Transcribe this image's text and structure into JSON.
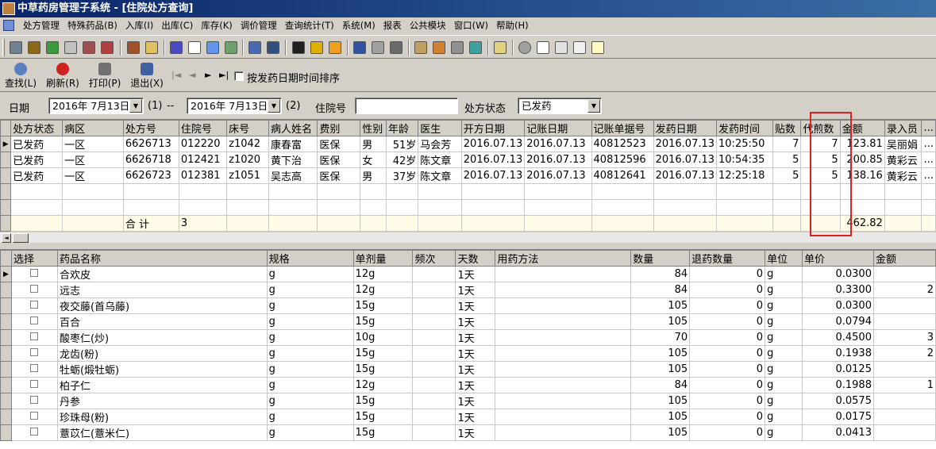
{
  "window": {
    "title": "中草药房管理子系统 - [住院处方查询]"
  },
  "menu": [
    "处方管理",
    "特殊药品(B)",
    "入库(I)",
    "出库(C)",
    "库存(K)",
    "调价管理",
    "查询统计(T)",
    "系统(M)",
    "报表",
    "公共模块",
    "窗口(W)",
    "帮助(H)"
  ],
  "toolbar": {
    "find": "查找(L)",
    "refresh": "刷新(R)",
    "print": "打印(P)",
    "exit": "退出(X)",
    "nav_first": "|◄",
    "nav_prev": "◄",
    "nav_next": "►",
    "nav_last": "►|",
    "sort_checkbox_label": "按发药日期时间排序"
  },
  "filter": {
    "date_label": "日期",
    "date_from": "2016年 7月13日",
    "from_marker": "(1)",
    "dash": "--",
    "date_to": "2016年 7月13日",
    "to_marker": "(2)",
    "inpatient_no_label": "住院号",
    "inpatient_no_value": "",
    "status_label": "处方状态",
    "status_value": "已发药"
  },
  "upper_grid": {
    "columns": [
      "处方状态",
      "病区",
      "处方号",
      "住院号",
      "床号",
      "病人姓名",
      "费别",
      "性别",
      "年龄",
      "医生",
      "开方日期",
      "记账日期",
      "记账单据号",
      "发药日期",
      "发药时间",
      "贴数",
      "代煎数",
      "金额",
      "录入员",
      "..."
    ],
    "rows": [
      [
        "已发药",
        "一区",
        "6626713",
        "012220",
        "z1042",
        "康春富",
        "医保",
        "男",
        "51岁",
        "马会芳",
        "2016.07.13",
        "2016.07.13",
        "40812523",
        "2016.07.13",
        "10:25:50",
        "7",
        "7",
        "123.81",
        "吴丽娟",
        "..."
      ],
      [
        "已发药",
        "一区",
        "6626718",
        "012421",
        "z1020",
        "黄下治",
        "医保",
        "女",
        "42岁",
        "陈文章",
        "2016.07.13",
        "2016.07.13",
        "40812596",
        "2016.07.13",
        "10:54:35",
        "5",
        "5",
        "200.85",
        "黄彩云",
        "..."
      ],
      [
        "已发药",
        "一区",
        "6626723",
        "012381",
        "z1051",
        "吴志高",
        "医保",
        "男",
        "37岁",
        "陈文章",
        "2016.07.13",
        "2016.07.13",
        "40812641",
        "2016.07.13",
        "12:25:18",
        "5",
        "5",
        "138.16",
        "黄彩云",
        "..."
      ]
    ],
    "summary": {
      "label": "合  计",
      "count": "3",
      "amount": "462.82"
    }
  },
  "lower_grid": {
    "columns": [
      "选择",
      "药品名称",
      "规格",
      "单剂量",
      "频次",
      "天数",
      "用药方法",
      "数量",
      "退药数量",
      "单位",
      "单价",
      "金额"
    ],
    "rows": [
      [
        "",
        "合欢皮",
        "g",
        "12g",
        "",
        "1天",
        "",
        "84",
        "0",
        "g",
        "0.0300",
        ""
      ],
      [
        "",
        "远志",
        "g",
        "12g",
        "",
        "1天",
        "",
        "84",
        "0",
        "g",
        "0.3300",
        "2"
      ],
      [
        "",
        "夜交藤(首乌藤)",
        "g",
        "15g",
        "",
        "1天",
        "",
        "105",
        "0",
        "g",
        "0.0300",
        ""
      ],
      [
        "",
        "百合",
        "g",
        "15g",
        "",
        "1天",
        "",
        "105",
        "0",
        "g",
        "0.0794",
        ""
      ],
      [
        "",
        "酸枣仁(炒)",
        "g",
        "10g",
        "",
        "1天",
        "",
        "70",
        "0",
        "g",
        "0.4500",
        "3"
      ],
      [
        "",
        "龙齿(粉)",
        "g",
        "15g",
        "",
        "1天",
        "",
        "105",
        "0",
        "g",
        "0.1938",
        "2"
      ],
      [
        "",
        "牡蛎(煅牡蛎)",
        "g",
        "15g",
        "",
        "1天",
        "",
        "105",
        "0",
        "g",
        "0.0125",
        ""
      ],
      [
        "",
        "柏子仁",
        "g",
        "12g",
        "",
        "1天",
        "",
        "84",
        "0",
        "g",
        "0.1988",
        "1"
      ],
      [
        "",
        "丹参",
        "g",
        "15g",
        "",
        "1天",
        "",
        "105",
        "0",
        "g",
        "0.0575",
        ""
      ],
      [
        "",
        "珍珠母(粉)",
        "g",
        "15g",
        "",
        "1天",
        "",
        "105",
        "0",
        "g",
        "0.0175",
        ""
      ],
      [
        "",
        "薏苡仁(薏米仁)",
        "g",
        "15g",
        "",
        "1天",
        "",
        "105",
        "0",
        "g",
        "0.0413",
        ""
      ]
    ]
  },
  "colors": {
    "highlight_box": "#e02020",
    "title_bar": "#0a246a",
    "summary_row": "#fffbe6"
  }
}
